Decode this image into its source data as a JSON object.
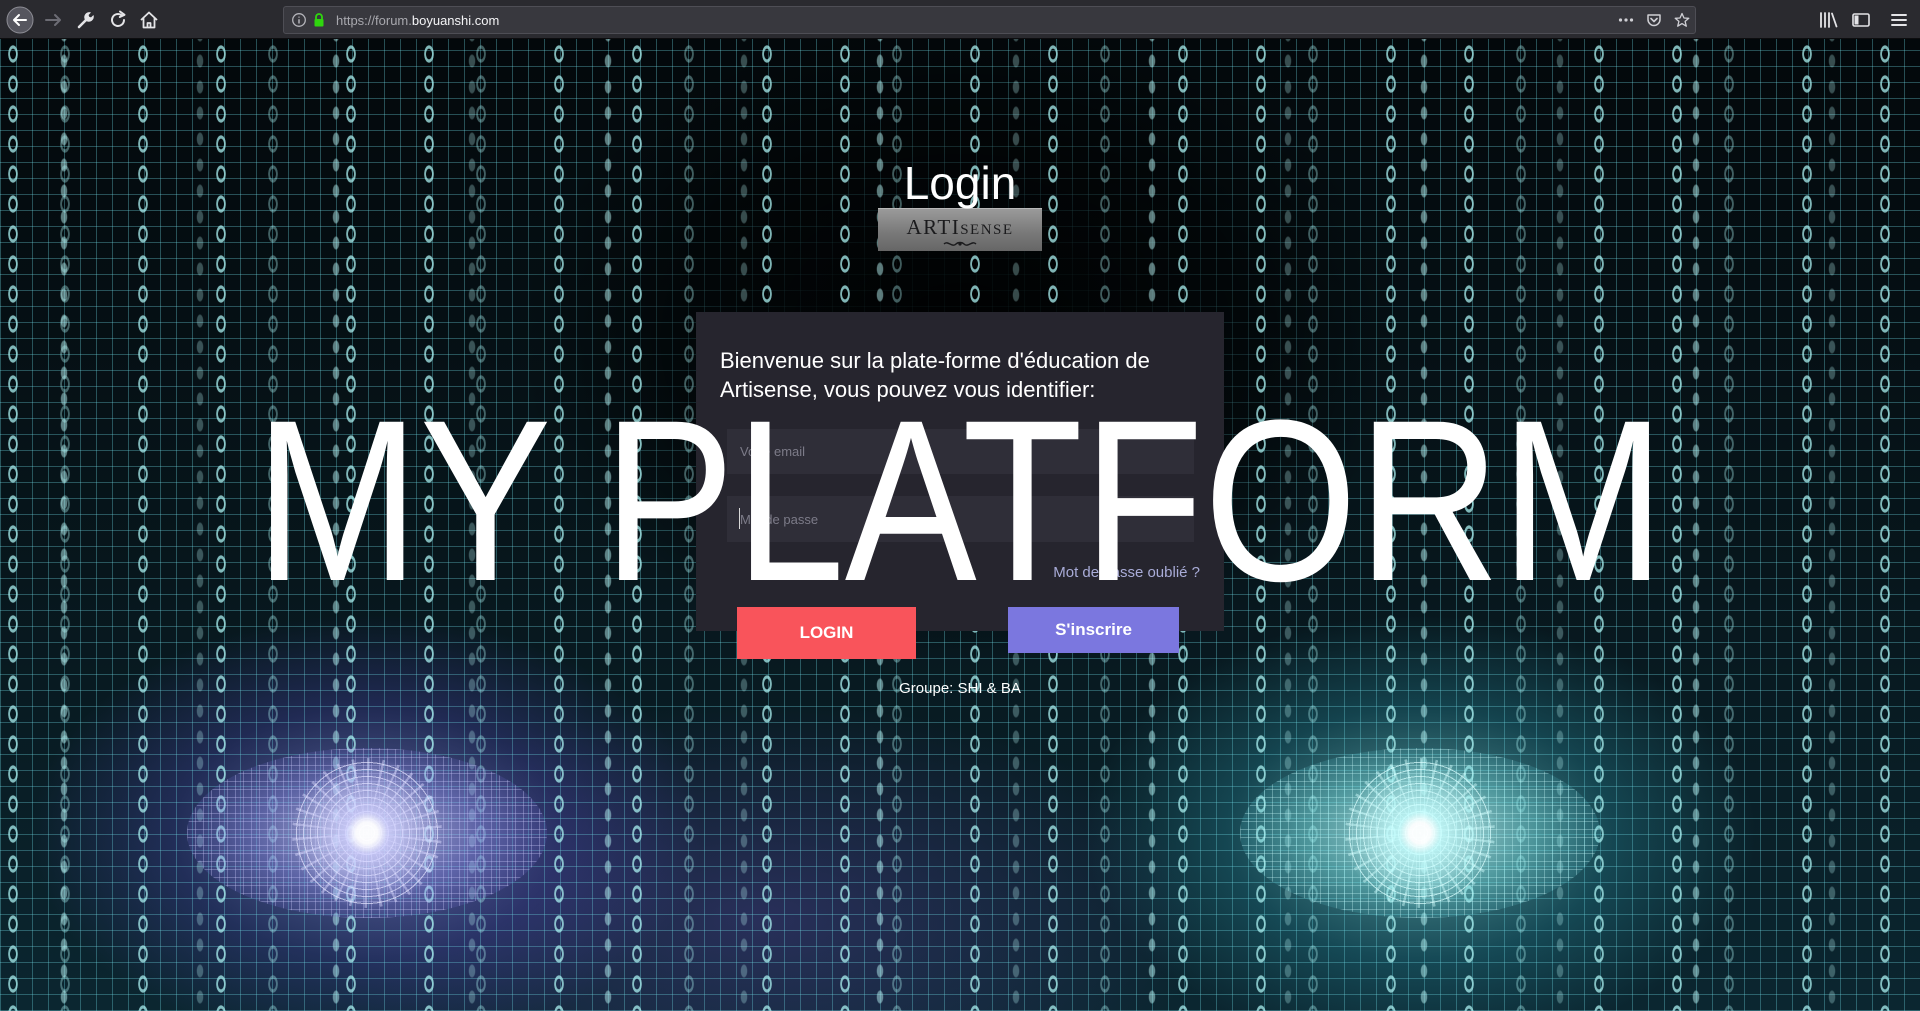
{
  "browser": {
    "url": {
      "prefix": "https://forum.",
      "domain": "boyuanshi.com"
    },
    "icons": {
      "back": "back-arrow-icon",
      "forward": "forward-arrow-icon",
      "tools": "wrench-icon",
      "reload": "reload-icon",
      "home": "home-icon",
      "info": "info-icon",
      "secure": "lock-icon",
      "page_actions": "more-dots-icon",
      "pocket": "pocket-icon",
      "bookmark": "star-icon",
      "library": "library-icon",
      "sidebar": "sidebar-icon",
      "menu": "hamburger-menu-icon"
    }
  },
  "login": {
    "heading": "Login",
    "logo": {
      "main": "ARTI",
      "sub": "SENSE"
    },
    "welcome": "Bienvenue sur la plate-forme d'éducation de Artisense, vous pouvez vous identifier:",
    "email": {
      "placeholder": "Votre email"
    },
    "password": {
      "placeholder": "Mot de passe"
    },
    "forgot_link": "Mot de passe oublié ?",
    "login_button": "LOGIN",
    "register_button": "S'inscrire",
    "group": "Groupe: SHI & BA"
  },
  "banner": {
    "title": "MY PLATFORM"
  },
  "colors": {
    "login_button": "#f9545b",
    "register_button": "#7b77df",
    "card": "#26252e",
    "forgot_link": "#a9acd8",
    "secure_lock": "#2fd60e"
  }
}
